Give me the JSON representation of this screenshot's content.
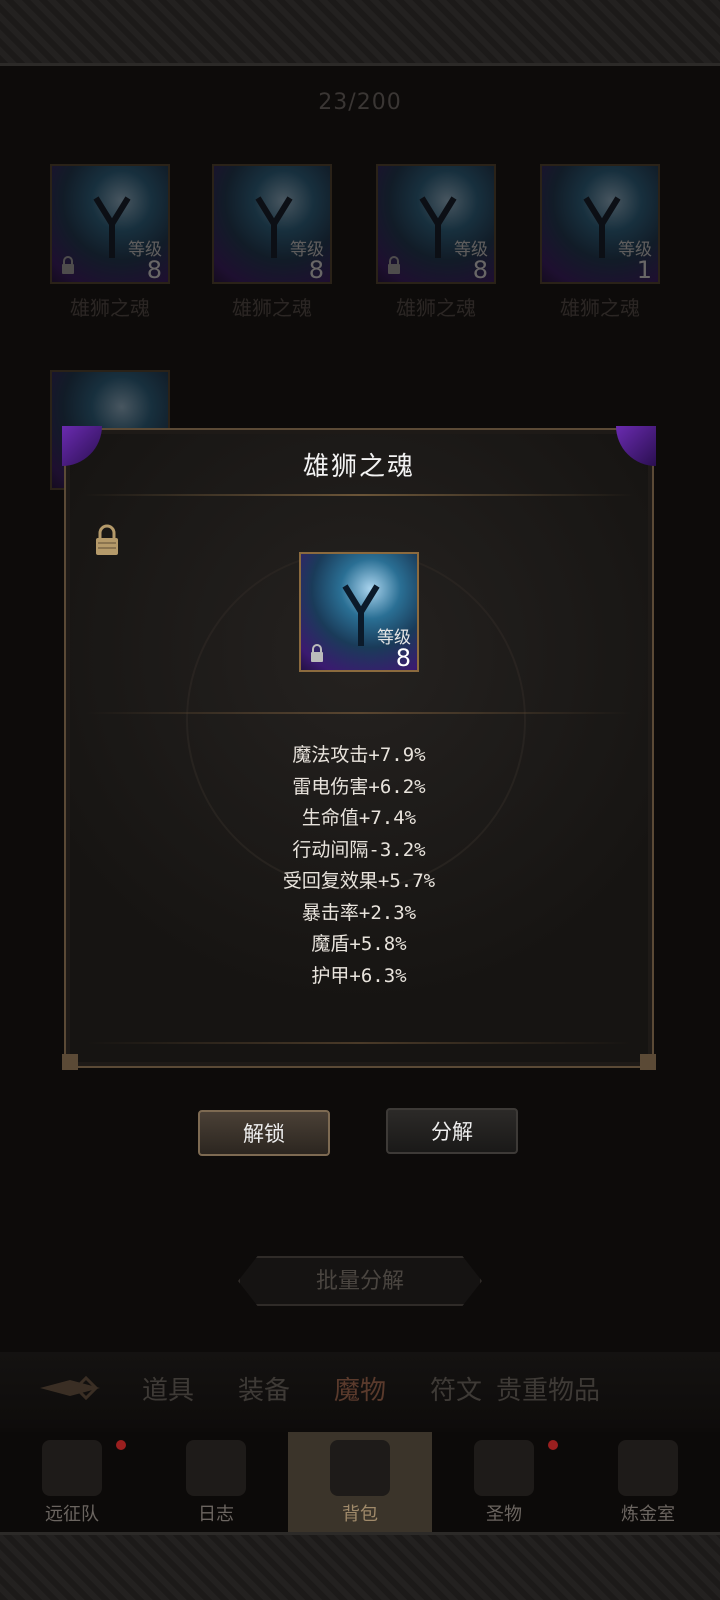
{
  "inventory": {
    "count": "23/200"
  },
  "items": [
    {
      "name": "雄狮之魂",
      "level_label": "等级",
      "level": "8",
      "locked": true
    },
    {
      "name": "雄狮之魂",
      "level_label": "等级",
      "level": "8",
      "locked": false
    },
    {
      "name": "雄狮之魂",
      "level_label": "等级",
      "level": "8",
      "locked": true
    },
    {
      "name": "雄狮之魂",
      "level_label": "等级",
      "level": "1",
      "locked": false
    }
  ],
  "detail": {
    "title": "雄狮之魂",
    "level_label": "等级",
    "level": "8",
    "stats": [
      "魔法攻击+7.9%",
      "雷电伤害+6.2%",
      "生命值+7.4%",
      "行动间隔-3.2%",
      "受回复效果+5.7%",
      "暴击率+2.3%",
      "魔盾+5.8%",
      "护甲+6.3%"
    ]
  },
  "buttons": {
    "unlock": "解锁",
    "decompose": "分解",
    "batch": "批量分解"
  },
  "tabs": [
    "道具",
    "装备",
    "魔物",
    "符文",
    "贵重物品"
  ],
  "active_tab": "魔物",
  "nav": [
    {
      "label": "远征队",
      "icon": "helmet-icon",
      "dot": true
    },
    {
      "label": "日志",
      "icon": "scroll-icon",
      "dot": false
    },
    {
      "label": "背包",
      "icon": "bag-icon",
      "dot": false
    },
    {
      "label": "圣物",
      "icon": "torch-icon",
      "dot": true
    },
    {
      "label": "炼金室",
      "icon": "alchemy-icon",
      "dot": false
    }
  ],
  "active_nav": "背包",
  "colors": {
    "rarity_purple": "#5a2a9a",
    "frame_gold": "#8b6a3e",
    "notify_red": "#9a1f1f"
  }
}
